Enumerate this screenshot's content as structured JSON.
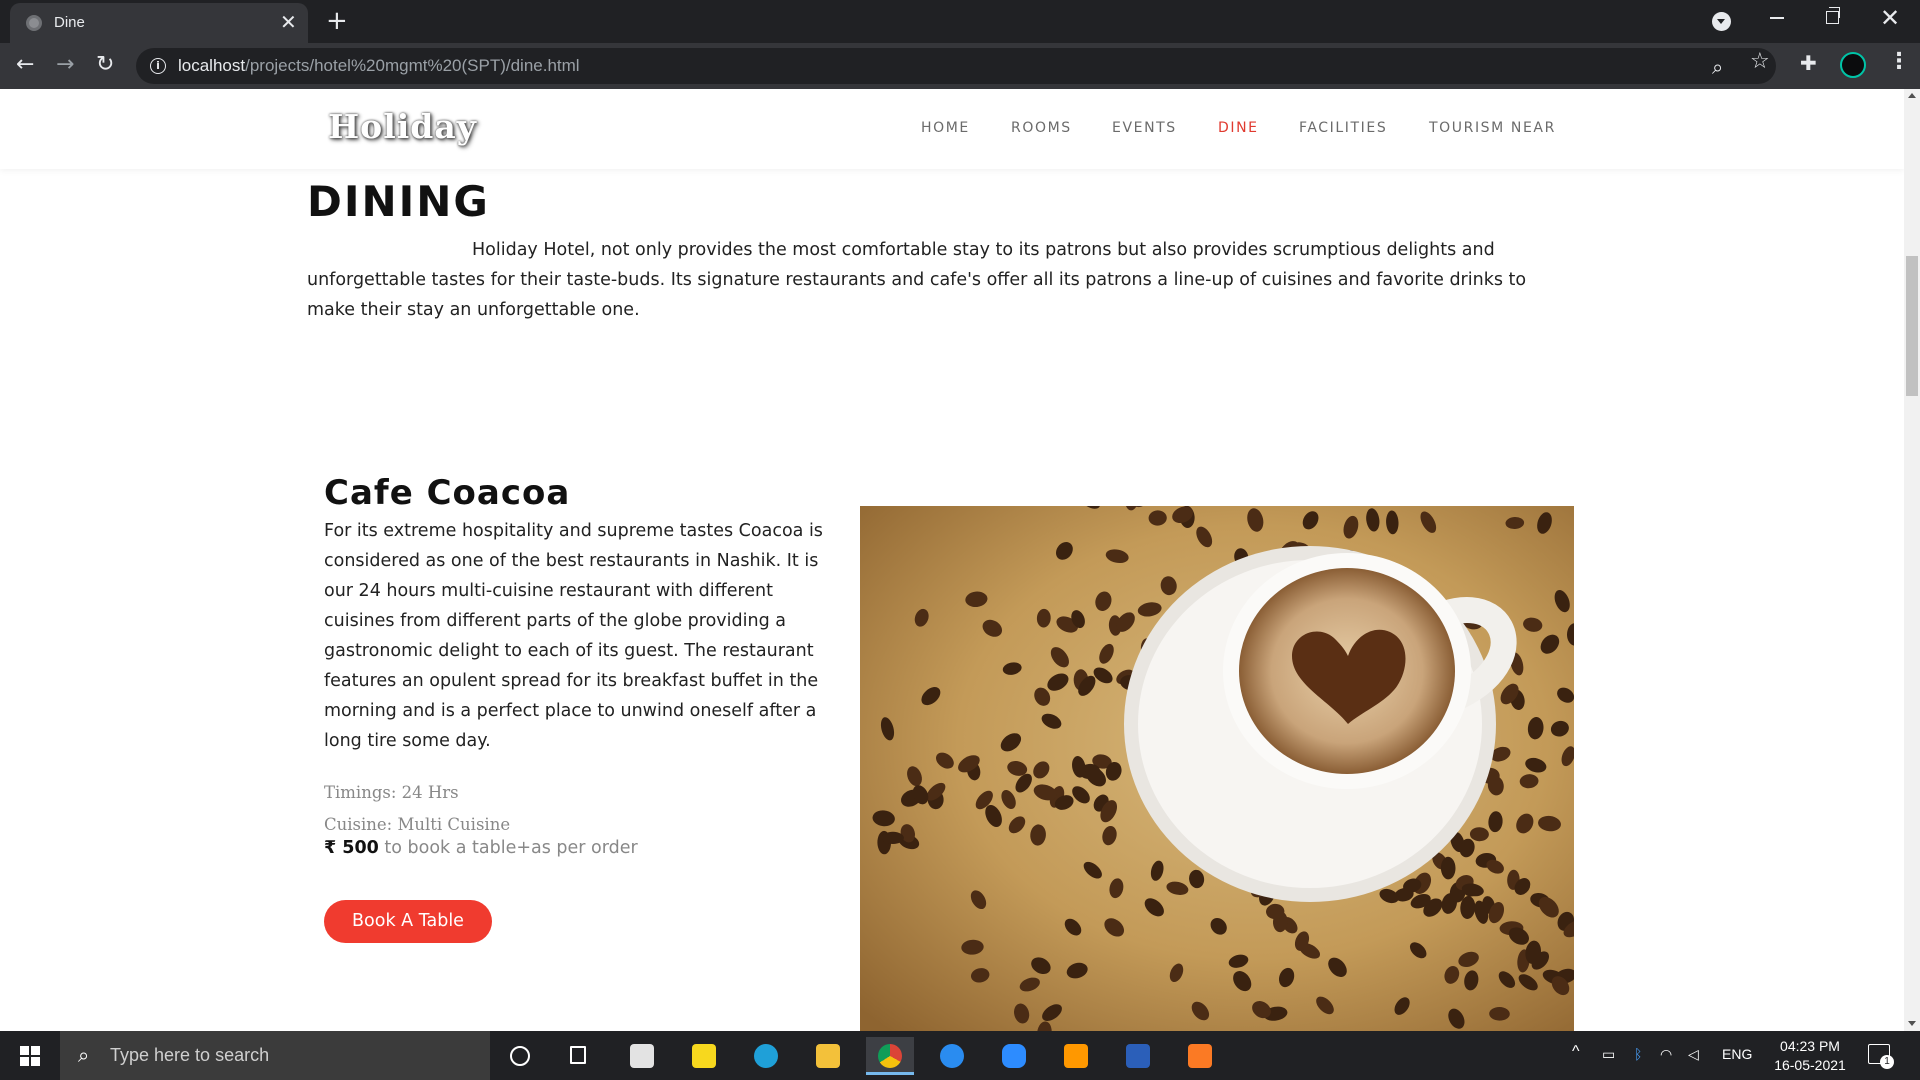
{
  "browser": {
    "tab_title": "Dine",
    "url_host": "localhost",
    "url_path": "/projects/hotel%20mgmt%20(SPT)/dine.html",
    "icons": [
      "favicon-icon",
      "close-icon",
      "plus-icon",
      "back-icon",
      "forward-icon",
      "reload-icon",
      "info-icon",
      "zoom-icon",
      "star-icon",
      "extensions-icon",
      "profile-avatar",
      "kebab-menu-icon"
    ]
  },
  "site": {
    "logo": "Holiday",
    "nav": [
      {
        "label": "HOME",
        "active": false
      },
      {
        "label": "ROOMS",
        "active": false
      },
      {
        "label": "EVENTS",
        "active": false
      },
      {
        "label": "DINE",
        "active": true
      },
      {
        "label": "FACILITIES",
        "active": false
      },
      {
        "label": "TOURISM NEAR",
        "active": false
      }
    ],
    "accent_color": "#f03b2f"
  },
  "dining": {
    "title": "DINING",
    "intro": "Holiday Hotel, not only provides the most comfortable stay to its patrons but also provides scrumptious delights and unforgettable tastes for their taste-buds. Its signature restaurants and cafe's offer all its patrons a line-up of cuisines and favorite drinks to make their stay an unforgettable one."
  },
  "cafe": {
    "name": "Cafe Coacoa",
    "description": "For its extreme hospitality and supreme tastes Coacoa is considered as one of the best restaurants in Nashik. It is our 24 hours multi-cuisine restaurant with different cuisines from different parts of the globe providing a gastronomic delight to each of its guest. The restaurant features an opulent spread for its breakfast buffet in the morning and is a perfect place to unwind oneself after a long tire some day.",
    "timings": "Timings: 24 Hrs",
    "cuisine": "Cuisine: Multi Cuisine",
    "price": "₹ 500",
    "price_note": " to book a table+as per order",
    "button": "Book A Table"
  },
  "taskbar": {
    "search_placeholder": "Type here to search",
    "apps": [
      "cortana-icon",
      "task-view-icon",
      "store-icon",
      "sticky-notes-icon",
      "edge-icon",
      "file-explorer-icon",
      "chrome-icon",
      "safari-icon",
      "zoom-app-icon",
      "sublime-text-icon",
      "word-icon",
      "xampp-icon"
    ],
    "tray_language": "ENG",
    "time": "04:23 PM",
    "date": "16-05-2021",
    "notification_count": "1"
  }
}
